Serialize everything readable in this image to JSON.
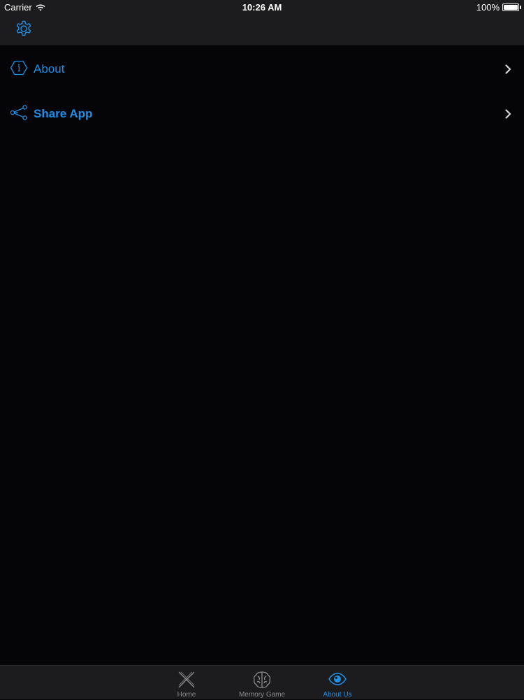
{
  "status_bar": {
    "carrier": "Carrier",
    "time": "10:26 AM",
    "battery_percent": "100%",
    "battery_level": 1.0,
    "icons": [
      "wifi-icon",
      "battery-icon"
    ]
  },
  "nav_bar": {
    "left_icon": "gear-icon"
  },
  "menu": {
    "items": [
      {
        "label": "About",
        "icon": "info-icon"
      },
      {
        "label": "Share App",
        "icon": "share-icon"
      }
    ]
  },
  "tab_bar": {
    "tabs": [
      {
        "label": "Home",
        "icon": "x-icon",
        "active": false
      },
      {
        "label": "Memory Game",
        "icon": "brain-icon",
        "active": false
      },
      {
        "label": "About Us",
        "icon": "eye-icon",
        "active": true
      }
    ]
  },
  "colors": {
    "accent": "#1e8fe8",
    "background": "#050507",
    "bar_background": "#1c1c1e",
    "inactive_tab": "#8a8a8e"
  }
}
